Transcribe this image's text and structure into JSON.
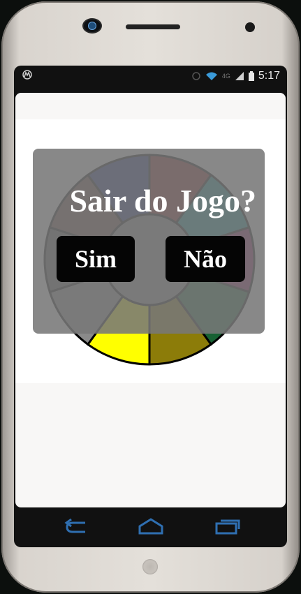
{
  "status_bar": {
    "notification_icon": "motorola-icon",
    "network_label": "4G",
    "time": "5:17",
    "icons": [
      "circle-icon",
      "wifi-icon",
      "signal-icon",
      "battery-icon"
    ]
  },
  "wheel": {
    "segment_colors": [
      "#8b1a1a",
      "#0f9591",
      "#8a0c59",
      "#176133",
      "#8c7c09",
      "#ffff00",
      "#8a8a8a",
      "#515151",
      "#68463a",
      "#1e2b85"
    ],
    "center_color": "#8c8c8c"
  },
  "dialog": {
    "title": "Sair do Jogo?",
    "yes_label": "Sim",
    "no_label": "Não"
  },
  "nav_bar": {
    "icons": [
      "back-icon",
      "home-icon",
      "recent-apps-icon"
    ],
    "accent": "#2f6fb1"
  }
}
